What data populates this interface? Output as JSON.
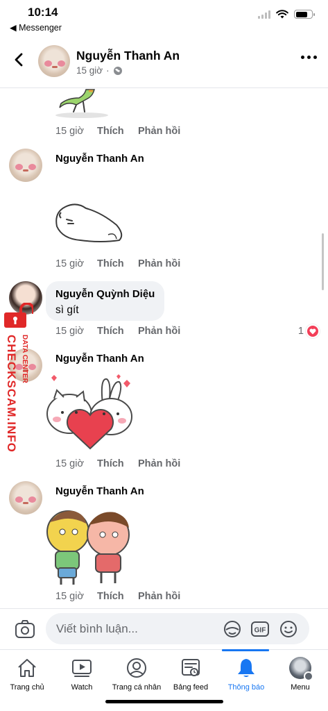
{
  "status_bar": {
    "time": "10:14",
    "back_app": "◀ Messenger"
  },
  "header": {
    "name": "Nguyễn Thanh An",
    "time": "15 giờ",
    "separator": "·"
  },
  "comments": [
    {
      "time": "15 giờ",
      "like": "Thích",
      "reply": "Phản hồi"
    },
    {
      "name": "Nguyễn Thanh An",
      "time": "15 giờ",
      "like": "Thích",
      "reply": "Phản hồi"
    },
    {
      "name": "Nguyễn Quỳnh Diệu",
      "text": "sì gít",
      "time": "15 giờ",
      "like": "Thích",
      "reply": "Phản hồi",
      "reaction_count": "1"
    },
    {
      "name": "Nguyễn Thanh An",
      "time": "15 giờ",
      "like": "Thích",
      "reply": "Phản hồi"
    },
    {
      "name": "Nguyễn Thanh An",
      "time": "15 giờ",
      "like": "Thích",
      "reply": "Phản hồi"
    }
  ],
  "watermark": {
    "main": "CHECKSCAM.INFO",
    "sub": "DATA CENTER"
  },
  "composer": {
    "placeholder": "Viết bình luận..."
  },
  "nav": [
    {
      "label": "Trang chủ",
      "icon": "home-icon"
    },
    {
      "label": "Watch",
      "icon": "watch-icon"
    },
    {
      "label": "Trang cá nhân",
      "icon": "profile-icon"
    },
    {
      "label": "Bảng feed",
      "icon": "feed-icon"
    },
    {
      "label": "Thông báo",
      "icon": "bell-icon",
      "active": true
    },
    {
      "label": "Menu",
      "icon": "menu-avatar"
    }
  ],
  "colors": {
    "accent": "#1877f2",
    "heart": "#f33e58",
    "watermark": "#e02828",
    "bubble": "#f0f2f5"
  }
}
